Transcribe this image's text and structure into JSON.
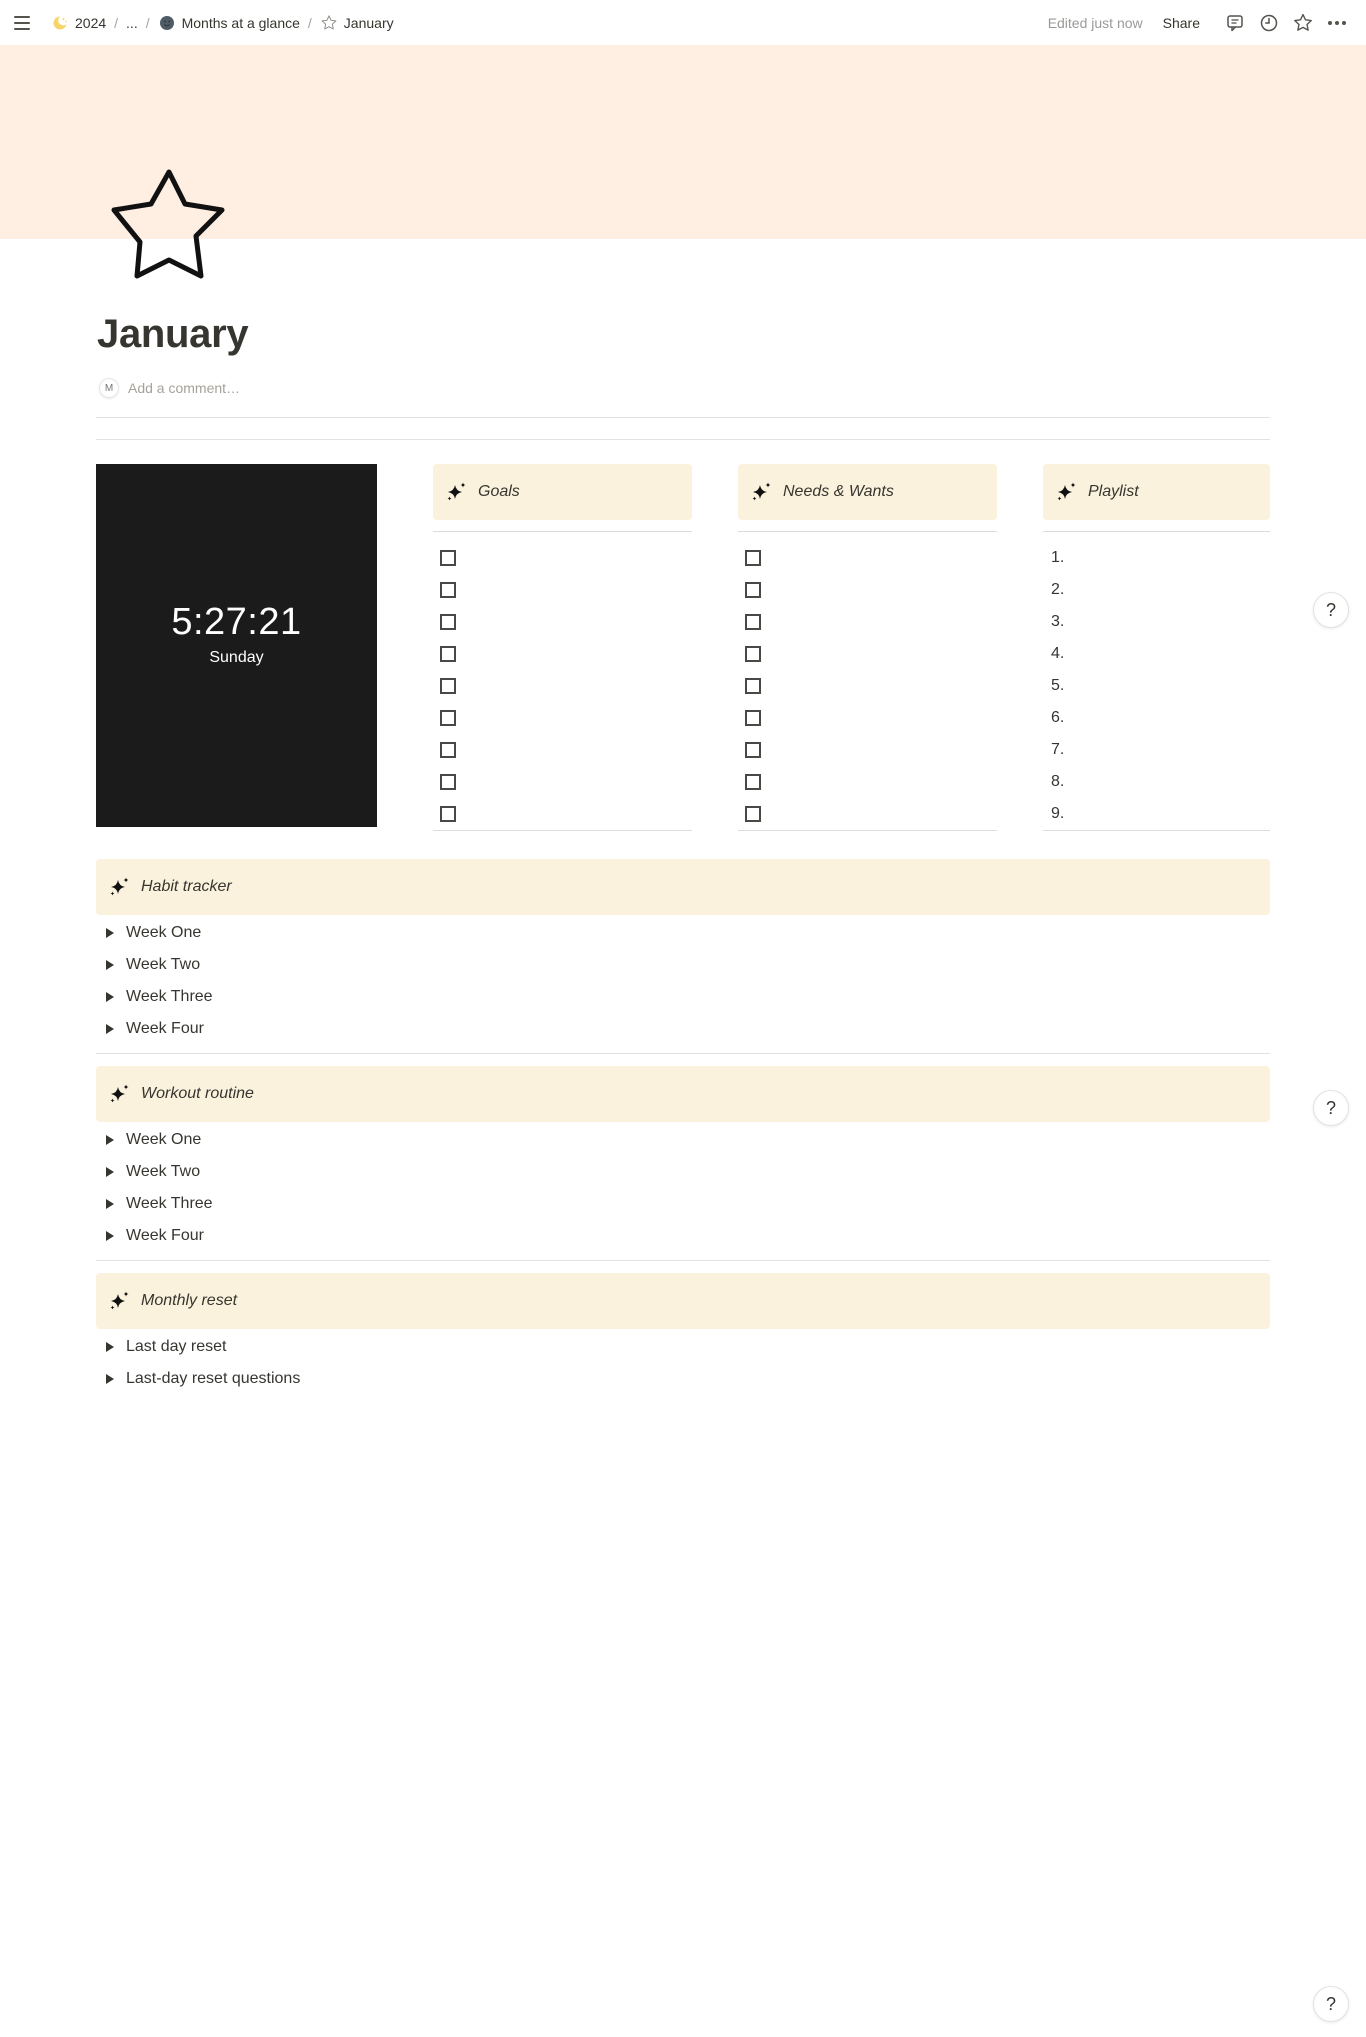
{
  "topbar": {
    "menu_icon": "hamburger-menu-icon",
    "breadcrumb": [
      {
        "label": "2024",
        "icon": "crescent-moon-stars-icon"
      },
      {
        "label": "...",
        "icon": null
      },
      {
        "label": "Months at a glance",
        "icon": "smiley-face-icon"
      },
      {
        "label": "January",
        "icon": "star-outline-icon"
      }
    ],
    "separator": "/",
    "edited_status": "Edited just now",
    "share_label": "Share",
    "icons": [
      "comment-icon",
      "clock-history-icon",
      "favorite-star-icon",
      "more-dots-icon"
    ]
  },
  "colors": {
    "cover": "#ffeee2",
    "callout_bg": "#fbf2de",
    "clock_bg": "#1b1b1b",
    "text": "#37352f",
    "muted": "#9b9a97"
  },
  "page": {
    "icon": "star-outline-icon",
    "title": "January",
    "comment_avatar": "M",
    "comment_placeholder": "Add a comment…"
  },
  "clock": {
    "time": "5:27:21",
    "day": "Sunday"
  },
  "columns": {
    "goals": {
      "title": "Goals",
      "items": 9
    },
    "needs": {
      "title": "Needs & Wants",
      "items": 9
    },
    "playlist": {
      "title": "Playlist",
      "numbers": [
        "1.",
        "2.",
        "3.",
        "4.",
        "5.",
        "6.",
        "7.",
        "8.",
        "9."
      ]
    }
  },
  "sections": [
    {
      "title": "Habit tracker",
      "toggles": [
        "Week One",
        "Week Two",
        "Week Three",
        "Week Four"
      ]
    },
    {
      "title": "Workout routine",
      "toggles": [
        "Week One",
        "Week Two",
        "Week Three",
        "Week Four"
      ]
    },
    {
      "title": "Monthly reset",
      "toggles": [
        "Last day reset",
        "Last-day reset questions"
      ]
    }
  ],
  "help": {
    "label": "?"
  }
}
